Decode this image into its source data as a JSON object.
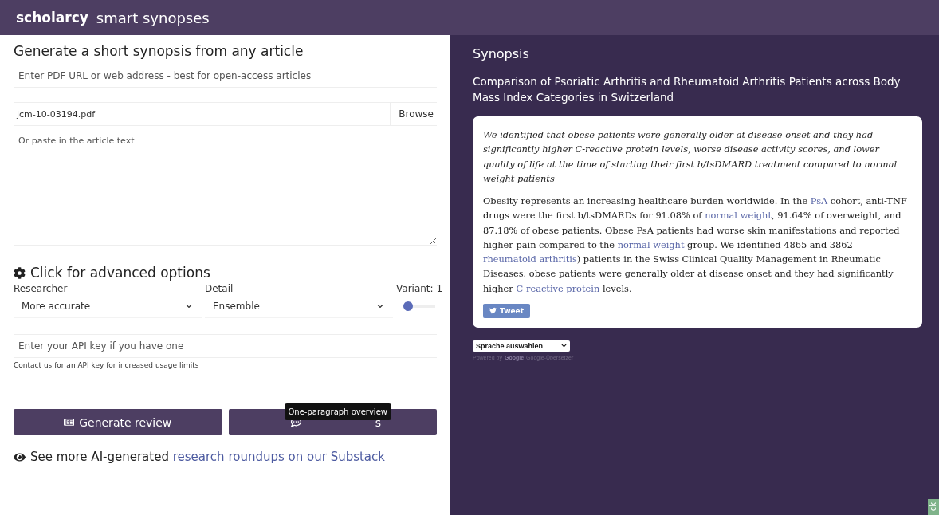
{
  "header": {
    "brand": "scholarcy",
    "title": "smart synopses"
  },
  "form": {
    "heading": "Generate a short synopsis from any article",
    "url_field": {
      "placeholder": "Enter PDF URL or web address - best for open-access articles"
    },
    "file_field": {
      "value": "jcm-10-03194.pdf",
      "button": "Browse"
    },
    "text_area": {
      "placeholder": "Or paste in the article text"
    },
    "advanced_heading": "Click for advanced options",
    "researcher": {
      "label": "Researcher",
      "value": "More accurate"
    },
    "detail": {
      "label": "Detail",
      "value": "Ensemble"
    },
    "variant": {
      "label": "Variant: 1",
      "level": 0
    },
    "api_field": {
      "placeholder": "Enter your API key if you have one"
    },
    "api_hint": "Contact us for an API key for increased usage limits",
    "review_button": "Generate review",
    "synopsis_button": {
      "visible_text": "s"
    },
    "tooltip": "One-paragraph overview",
    "substack": {
      "text": "See more AI-generated",
      "link": "research roundups on our Substack"
    }
  },
  "synopsis": {
    "heading": "Synopsis",
    "article_title": "Comparison of Psoriatic Arthritis and Rheumatoid Arthritis Patients across Body Mass Index Categories in Switzerland",
    "highlight": "We identified that obese patients were generally older at disease onset and they had significantly higher C-reactive protein levels, worse disease activity scores, and lower quality of life at the time of starting their first b/tsDMARD treatment compared to normal weight patients",
    "body": [
      {
        "text": "Obesity represents an increasing healthcare burden worldwide. In the ",
        "link": false
      },
      {
        "text": "PsA",
        "link": true
      },
      {
        "text": " cohort, anti-TNF drugs were the first b/tsDMARDs for 91.08% of ",
        "link": false
      },
      {
        "text": "normal weight",
        "link": true
      },
      {
        "text": ", 91.64% of overweight, and 87.18% of obese patients. Obese PsA patients had worse skin manifestations and reported higher pain compared to the ",
        "link": false
      },
      {
        "text": "normal weight",
        "link": true
      },
      {
        "text": " group. We identified 4865 and 3862 ",
        "link": false
      },
      {
        "text": "rheumatoid arthritis",
        "link": true
      },
      {
        "text": ") patients in the Swiss Clinical Quality Management in Rheumatic Diseases. obese patients were generally older at disease onset and they had significantly higher ",
        "link": false
      },
      {
        "text": "C-reactive protein",
        "link": true
      },
      {
        "text": " levels.",
        "link": false
      }
    ],
    "tweet_button": "Tweet",
    "language_select": "Sprache auswählen",
    "powered_by": "Powered by",
    "google": "Google",
    "translator": "Google-Übersetzer"
  },
  "feedback_tab": "ck"
}
